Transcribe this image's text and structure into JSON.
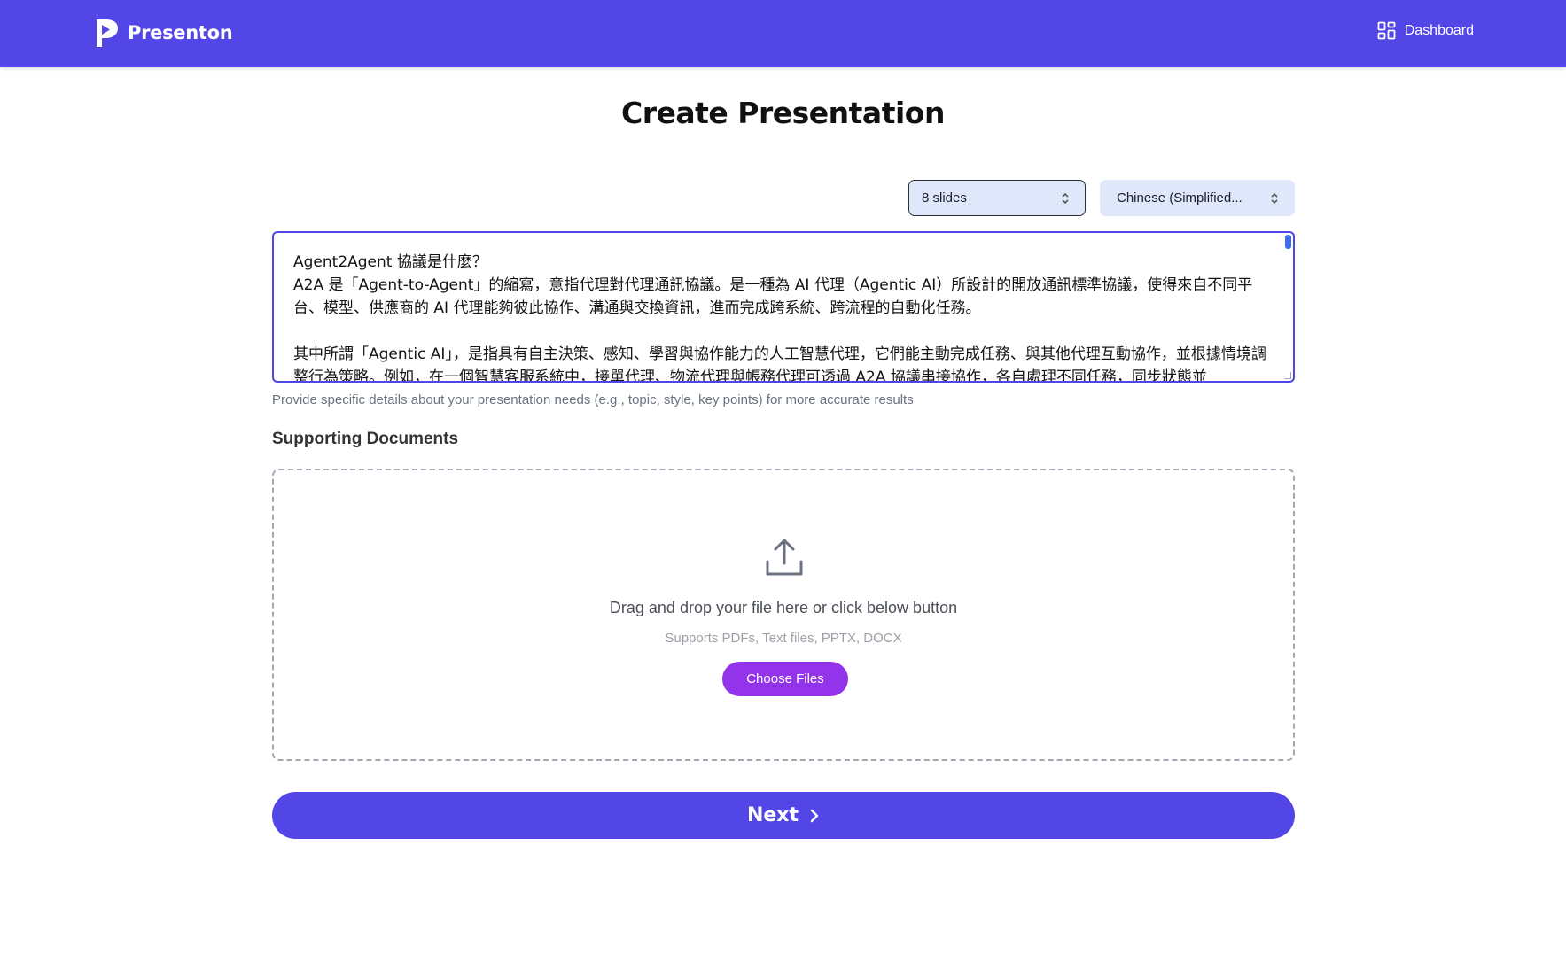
{
  "header": {
    "brand": "Presenton",
    "dashboard_label": "Dashboard",
    "icons": {
      "logo": "presenton-logo",
      "dashboard": "dashboard-grid-icon"
    },
    "bg_color": "#5346e6"
  },
  "page": {
    "title": "Create Presentation"
  },
  "controls": {
    "slides_value": "8 slides",
    "language_value": "Chinese (Simplified..."
  },
  "prompt": {
    "text": "Agent2Agent 協議是什麼？\nA2A 是「Agent-to-Agent」的縮寫，意指代理對代理通訊協議。是一種為 AI 代理（Agentic AI）所設計的開放通訊標準協議，使得來自不同平台、模型、供應商的 AI 代理能夠彼此協作、溝通與交換資訊，進而完成跨系統、跨流程的自動化任務。\n\n其中所謂「Agentic AI」，是指具有自主決策、感知、學習與協作能力的人工智慧代理，它們能主動完成任務、與其他代理互動協作，並根據情境調整行為策略。例如，在一個智慧客服系統中，接單代理、物流代理與帳務代理可透過 A2A 協議串接協作，各自處理不同任務，同步狀態並",
    "helper": "Provide specific details about your presentation needs (e.g., topic, style, key points) for more accurate results"
  },
  "documents": {
    "section_label": "Supporting Documents",
    "drop_title": "Drag and drop your file here or click below button",
    "drop_subtitle": "Supports PDFs, Text files, PPTX, DOCX",
    "choose_label": "Choose Files",
    "icon": "upload-icon",
    "button_color": "#9333ea"
  },
  "actions": {
    "next_label": "Next",
    "next_color": "#5346e6"
  }
}
